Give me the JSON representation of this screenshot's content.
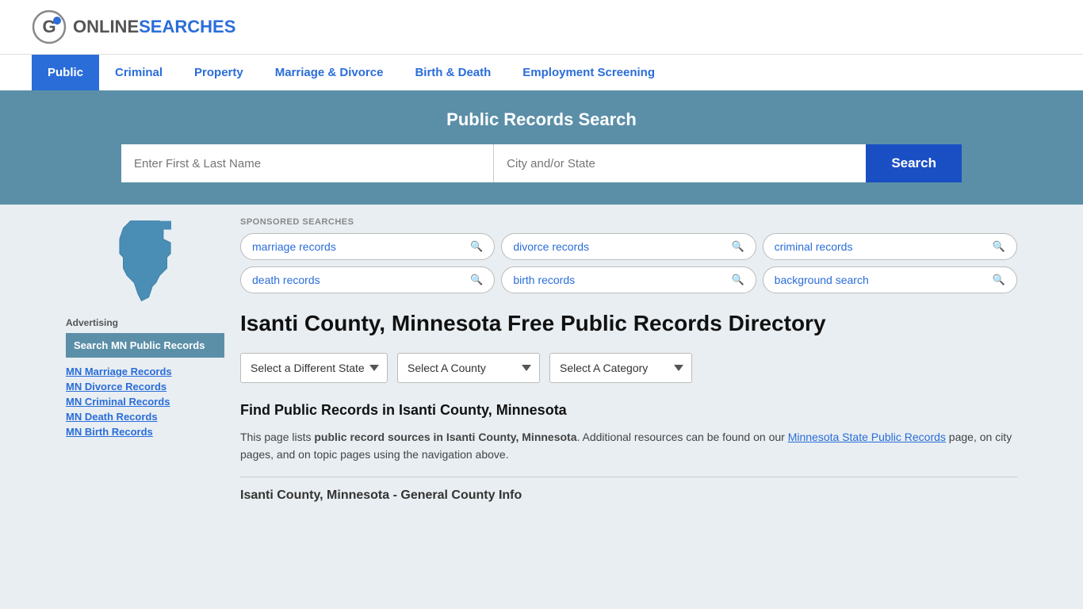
{
  "logo": {
    "online": "ONLINE",
    "searches": "SEARCHES"
  },
  "nav": {
    "items": [
      {
        "label": "Public",
        "active": true
      },
      {
        "label": "Criminal",
        "active": false
      },
      {
        "label": "Property",
        "active": false
      },
      {
        "label": "Marriage & Divorce",
        "active": false
      },
      {
        "label": "Birth & Death",
        "active": false
      },
      {
        "label": "Employment Screening",
        "active": false
      }
    ]
  },
  "hero": {
    "title": "Public Records Search",
    "name_placeholder": "Enter First & Last Name",
    "location_placeholder": "City and/or State",
    "search_label": "Search"
  },
  "sponsored": {
    "label": "SPONSORED SEARCHES",
    "pills": [
      {
        "label": "marriage records"
      },
      {
        "label": "divorce records"
      },
      {
        "label": "criminal records"
      },
      {
        "label": "death records"
      },
      {
        "label": "birth records"
      },
      {
        "label": "background search"
      }
    ]
  },
  "page_heading": "Isanti County, Minnesota Free Public Records Directory",
  "dropdowns": {
    "state": {
      "label": "Select a Different State"
    },
    "county": {
      "label": "Select A County"
    },
    "category": {
      "label": "Select A Category"
    }
  },
  "find_heading": "Find Public Records in Isanti County, Minnesota",
  "description": {
    "text_before": "This page lists ",
    "bold": "public record sources in Isanti County, Minnesota",
    "text_after": ". Additional resources can be found on our ",
    "link_text": "Minnesota State Public Records",
    "text_end": " page, on city pages, and on topic pages using the navigation above."
  },
  "sidebar": {
    "state_label": "Minnesota",
    "ad_label": "Advertising",
    "ad_box_text": "Search MN Public Records",
    "links": [
      {
        "label": "MN Marriage Records"
      },
      {
        "label": "MN Divorce Records"
      },
      {
        "label": "MN Criminal Records"
      },
      {
        "label": "MN Death Records"
      },
      {
        "label": "MN Birth Records"
      }
    ]
  },
  "section_sub_heading": "Isanti County, Minnesota - General County Info"
}
